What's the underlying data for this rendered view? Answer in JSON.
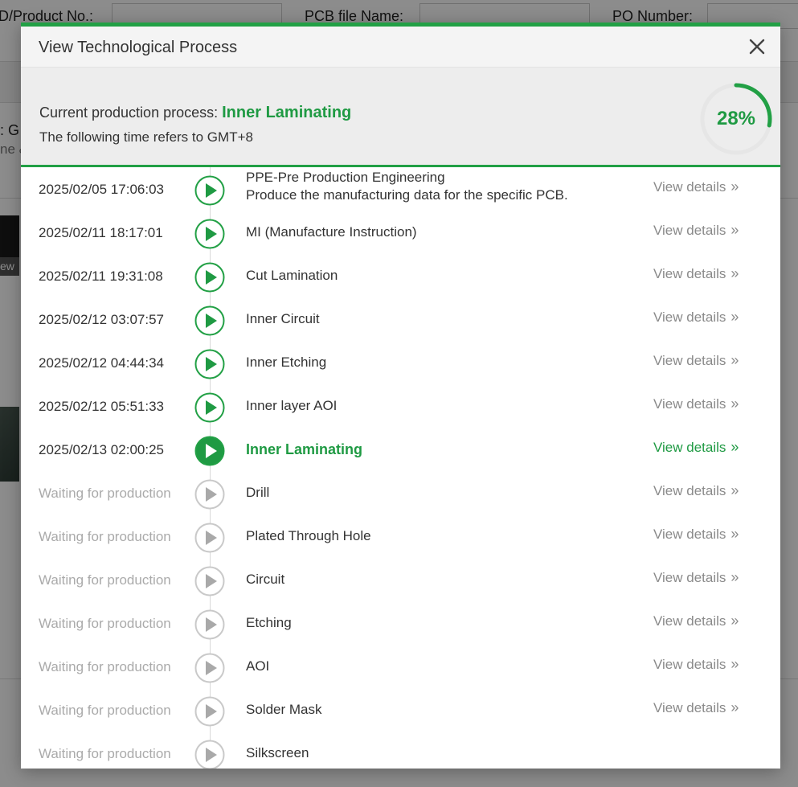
{
  "background": {
    "labels": [
      "D/Product No.:",
      "PCB file Name:",
      "PO Number:"
    ],
    "side_text": ": G",
    "side_text2": "ne &",
    "thumb_label": "ew"
  },
  "modal": {
    "title": "View Technological Process",
    "current_label": "Current production process:",
    "current_value": "Inner Laminating",
    "timezone_note": "The following time refers to GMT+8",
    "progress_percent": 28,
    "progress_label": "28%"
  },
  "colors": {
    "accent": "#1f9a43",
    "waiting": "#aaaaaa",
    "ring_track": "#e6e6e6"
  },
  "steps": [
    {
      "time": "2025/02/05 17:06:03",
      "name": "PPE-Pre Production Engineering",
      "sub": "Produce the manufacturing data for the specific PCB.",
      "status": "done",
      "details": "View details"
    },
    {
      "time": "2025/02/11 18:17:01",
      "name": "MI (Manufacture Instruction)",
      "status": "done",
      "details": "View details"
    },
    {
      "time": "2025/02/11 19:31:08",
      "name": "Cut Lamination",
      "status": "done",
      "details": "View details"
    },
    {
      "time": "2025/02/12 03:07:57",
      "name": "Inner Circuit",
      "status": "done",
      "details": "View details"
    },
    {
      "time": "2025/02/12 04:44:34",
      "name": "Inner Etching",
      "status": "done",
      "details": "View details"
    },
    {
      "time": "2025/02/12 05:51:33",
      "name": "Inner layer AOI",
      "status": "done",
      "details": "View details"
    },
    {
      "time": "2025/02/13 02:00:25",
      "name": "Inner Laminating",
      "status": "current",
      "details": "View details"
    },
    {
      "time": "Waiting for production",
      "name": "Drill",
      "status": "waiting",
      "details": "View details"
    },
    {
      "time": "Waiting for production",
      "name": "Plated Through Hole",
      "status": "waiting",
      "details": "View details"
    },
    {
      "time": "Waiting for production",
      "name": "Circuit",
      "status": "waiting",
      "details": "View details"
    },
    {
      "time": "Waiting for production",
      "name": "Etching",
      "status": "waiting",
      "details": "View details"
    },
    {
      "time": "Waiting for production",
      "name": "AOI",
      "status": "waiting",
      "details": "View details"
    },
    {
      "time": "Waiting for production",
      "name": "Solder Mask",
      "status": "waiting",
      "details": "View details"
    },
    {
      "time": "Waiting for production",
      "name": "Silkscreen",
      "status": "waiting",
      "details": ""
    }
  ]
}
